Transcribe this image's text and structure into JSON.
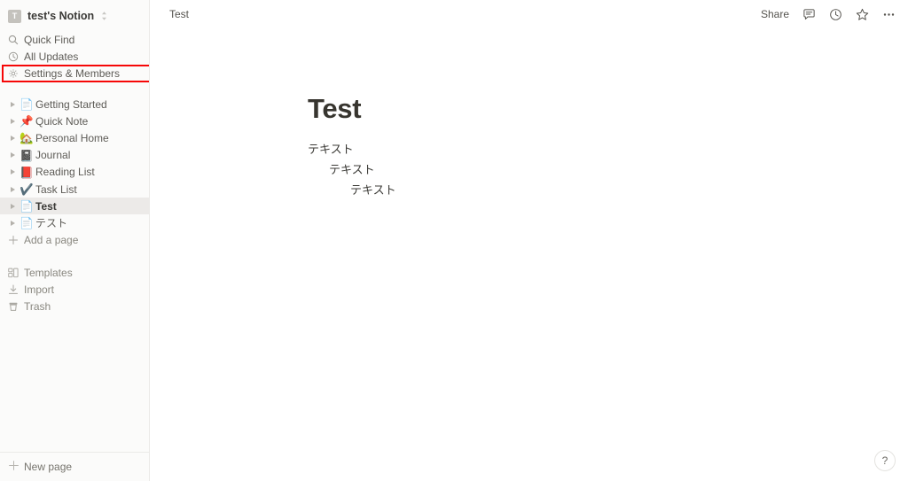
{
  "sidebar": {
    "workspace": {
      "avatar_letter": "T",
      "name": "test's Notion",
      "switcher_icon": "chevron-up-down-icon"
    },
    "nav": [
      {
        "icon": "search-icon",
        "label": "Quick Find"
      },
      {
        "icon": "clock-icon",
        "label": "All Updates"
      }
    ],
    "settings": {
      "icon": "gear-icon",
      "label": "Settings & Members"
    },
    "pages": [
      {
        "emoji": "📄",
        "icon_name": "document-icon",
        "label": "Getting Started",
        "active": false
      },
      {
        "emoji": "📌",
        "icon_name": "pushpin-icon",
        "label": "Quick Note",
        "active": false
      },
      {
        "emoji": "🏡",
        "icon_name": "house-with-garden-icon",
        "label": "Personal Home",
        "active": false
      },
      {
        "emoji": "📓",
        "icon_name": "notebook-icon",
        "label": "Journal",
        "active": false
      },
      {
        "emoji": "📕",
        "icon_name": "closed-book-icon",
        "label": "Reading List",
        "active": false
      },
      {
        "emoji": "✔️",
        "icon_name": "check-mark-icon",
        "label": "Task List",
        "active": false
      },
      {
        "emoji": "📄",
        "icon_name": "document-icon",
        "label": "Test",
        "active": true
      },
      {
        "emoji": "📄",
        "icon_name": "document-icon",
        "label": "テスト",
        "active": false
      }
    ],
    "add_page": {
      "icon": "plus-icon",
      "label": "Add a page"
    },
    "utility": [
      {
        "icon": "templates-icon",
        "label": "Templates"
      },
      {
        "icon": "import-icon",
        "label": "Import"
      },
      {
        "icon": "trash-icon",
        "label": "Trash"
      }
    ],
    "footer": {
      "icon": "plus-icon",
      "label": "New page"
    }
  },
  "topbar": {
    "breadcrumb": "Test",
    "share_label": "Share",
    "icons": [
      {
        "name": "comment-icon"
      },
      {
        "name": "clock-history-icon"
      },
      {
        "name": "star-icon"
      },
      {
        "name": "more-horizontal-icon"
      }
    ]
  },
  "document": {
    "title": "Test",
    "blocks": [
      {
        "text": "テキスト",
        "indent": 0
      },
      {
        "text": "テキスト",
        "indent": 1
      },
      {
        "text": "テキスト",
        "indent": 2
      }
    ]
  },
  "help": {
    "label": "?"
  },
  "annotation": {
    "color": "#f60707",
    "target": "Settings & Members"
  }
}
